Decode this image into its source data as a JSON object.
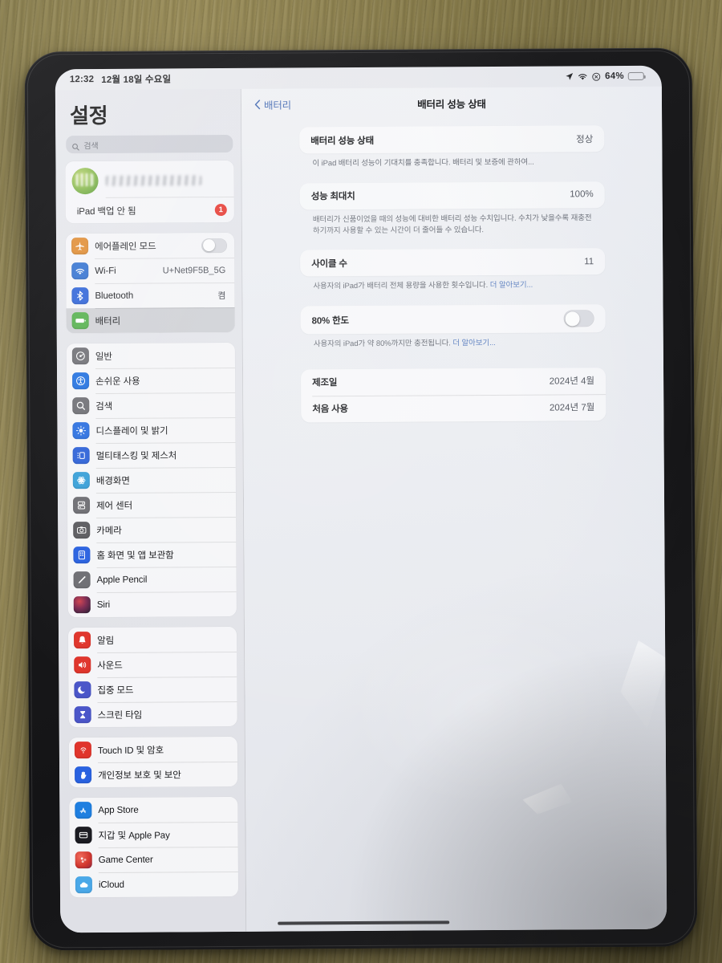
{
  "status_bar": {
    "time": "12:32",
    "date": "12월 18일 수요일",
    "battery_percent": "64%",
    "icons": [
      "location-arrow-icon",
      "wifi-icon",
      "lock-rotation-icon",
      "battery-icon"
    ]
  },
  "sidebar": {
    "title": "설정",
    "search": {
      "placeholder": "검색",
      "value": ""
    },
    "apple_id": {
      "name_redacted": "",
      "backup_label": "iPad 백업 안 됨",
      "badge": "1"
    },
    "groups": [
      {
        "items": [
          {
            "label": "에어플레인 모드",
            "icon": "airplane-icon",
            "color": "#e08a2e",
            "control": "toggle",
            "toggle_on": false
          },
          {
            "label": "Wi-Fi",
            "icon": "wifi-icon",
            "color": "#2f6fd0",
            "value": "U+Net9F5B_5G"
          },
          {
            "label": "Bluetooth",
            "icon": "bluetooth-icon",
            "color": "#2b61d8",
            "value": "켬"
          },
          {
            "label": "배터리",
            "icon": "battery-icon",
            "color": "#53b04a",
            "selected": true
          }
        ]
      },
      {
        "items": [
          {
            "label": "일반",
            "icon": "gear-icon",
            "color": "#6e6e73"
          },
          {
            "label": "손쉬운 사용",
            "icon": "accessibility-icon",
            "color": "#1f6fe0"
          },
          {
            "label": "검색",
            "icon": "search-icon",
            "color": "#6e6e73"
          },
          {
            "label": "디스플레이 및 밝기",
            "icon": "brightness-icon",
            "color": "#2a6fe0"
          },
          {
            "label": "멀티태스킹 및 제스처",
            "icon": "multitasking-icon",
            "color": "#2e62d8"
          },
          {
            "label": "배경화면",
            "icon": "wallpaper-icon",
            "color": "#39a0d8"
          },
          {
            "label": "제어 센터",
            "icon": "control-center-icon",
            "color": "#6e6e73"
          },
          {
            "label": "카메라",
            "icon": "camera-icon",
            "color": "#5c5c60"
          },
          {
            "label": "홈 화면 및 앱 보관함",
            "icon": "home-screen-icon",
            "color": "#2a62e0"
          },
          {
            "label": "Apple Pencil",
            "icon": "pencil-icon",
            "color": "#6e6e73"
          },
          {
            "label": "Siri",
            "icon": "siri-icon",
            "color": "#1c1c22"
          }
        ]
      },
      {
        "items": [
          {
            "label": "알림",
            "icon": "bell-icon",
            "color": "#e0352c"
          },
          {
            "label": "사운드",
            "icon": "speaker-icon",
            "color": "#e0352c"
          },
          {
            "label": "집중 모드",
            "icon": "moon-icon",
            "color": "#4b56c9"
          },
          {
            "label": "스크린 타임",
            "icon": "hourglass-icon",
            "color": "#4b56c9"
          }
        ]
      },
      {
        "items": [
          {
            "label": "Touch ID 및 암호",
            "icon": "fingerprint-icon",
            "color": "#e0352c"
          },
          {
            "label": "개인정보 보호 및 보안",
            "icon": "hand-privacy-icon",
            "color": "#2a62e0"
          }
        ]
      },
      {
        "items": [
          {
            "label": "App Store",
            "icon": "app-store-icon",
            "color": "#1f7fe0"
          },
          {
            "label": "지갑 및 Apple Pay",
            "icon": "wallet-icon",
            "color": "#1c1c22"
          },
          {
            "label": "Game Center",
            "icon": "game-center-icon",
            "color": "#e0483c"
          },
          {
            "label": "iCloud",
            "icon": "icloud-icon",
            "color": "#4aa8e8"
          }
        ]
      }
    ]
  },
  "detail": {
    "back_label": "배터리",
    "title": "배터리 성능 상태",
    "sections": [
      {
        "rows": [
          {
            "label": "배터리 성능 상태",
            "value": "정상"
          }
        ],
        "footnote": "이 iPad 배터리 성능이 기대치를 충족합니다. 배터리 및 보증에 관하여...",
        "footnote_link": ""
      },
      {
        "rows": [
          {
            "label": "성능 최대치",
            "value": "100%"
          }
        ],
        "footnote": "배터리가 신품이었을 때의 성능에 대비한 배터리 성능 수치입니다. 수치가 낮을수록 재충전하기까지 사용할 수 있는 시간이 더 줄어들 수 있습니다.",
        "footnote_link": ""
      },
      {
        "rows": [
          {
            "label": "사이클 수",
            "value": "11"
          }
        ],
        "footnote": "사용자의 iPad가 배터리 전체 용량을 사용한 횟수입니다. ",
        "footnote_link": "더 알아보기..."
      },
      {
        "rows": [
          {
            "label": "80% 한도",
            "control": "toggle",
            "toggle_on": false
          }
        ],
        "footnote": "사용자의 iPad가 약 80%까지만 충전됩니다. ",
        "footnote_link": "더 알아보기..."
      },
      {
        "rows": [
          {
            "label": "제조일",
            "value": "2024년 4월"
          },
          {
            "label": "처음 사용",
            "value": "2024년 7월"
          }
        ],
        "footnote": "",
        "footnote_link": ""
      }
    ]
  }
}
